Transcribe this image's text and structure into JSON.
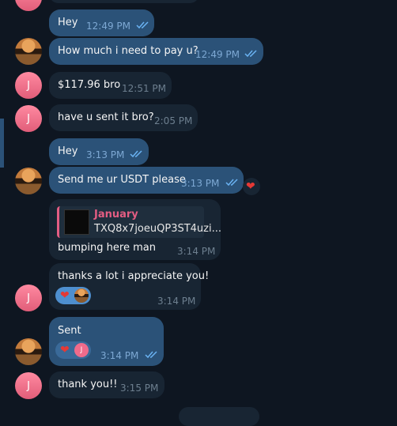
{
  "messages": [
    {
      "text": "Hey",
      "time": "12:49 PM"
    },
    {
      "text": "How much i need to pay u?",
      "time": "12:49 PM"
    },
    {
      "text": "$117.96 bro",
      "time": "12:51 PM"
    },
    {
      "text": "have u sent it bro?",
      "time": "2:05 PM"
    },
    {
      "text": "Hey",
      "time": "3:13 PM"
    },
    {
      "text": "Send me ur USDT please",
      "time": "3:13 PM"
    },
    {
      "text": "bumping here man",
      "time": "3:14 PM",
      "reply": {
        "name": "January",
        "text": "TXQ8x7joeuQP3ST4uzi..."
      }
    },
    {
      "text": "thanks a lot i appreciate you!",
      "time": "3:14 PM"
    },
    {
      "text": "Sent",
      "time": "3:14 PM"
    },
    {
      "text": "thank you!!",
      "time": "3:15 PM"
    }
  ],
  "avatar_initial": "J",
  "reaction_icon": "heart-icon",
  "colors": {
    "background": "#0e1621",
    "outgoing_bubble": "#2b5278",
    "incoming_bubble": "#182533",
    "accent_name": "#e35d83",
    "heart": "#e53935"
  }
}
